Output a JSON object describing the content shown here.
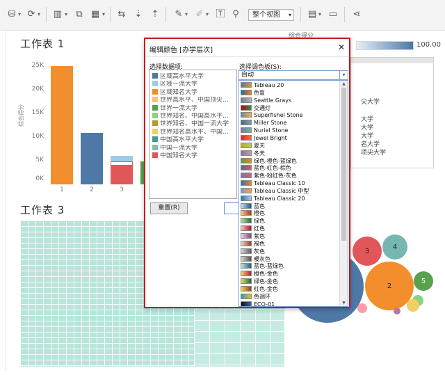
{
  "toolbar": {
    "view_select": "整个视图",
    "icons": [
      "database-icon",
      "refresh-icon",
      "add-chart-icon",
      "duplicate-icon",
      "clear-icon",
      "swap-icon",
      "sort-asc-icon",
      "sort-desc-icon",
      "highlight-icon",
      "pen-icon",
      "label-icon",
      "pin-icon",
      "show-me-icon",
      "presentation-icon",
      "share-icon"
    ]
  },
  "worksheet1": {
    "title": "工作表 1",
    "ylabel": "综合得分",
    "yticks": [
      "25K",
      "20K",
      "15K",
      "10K",
      "5K",
      "0K"
    ],
    "xticks": [
      "1",
      "2",
      "3"
    ]
  },
  "worksheet3": {
    "title": "工作表 3"
  },
  "legend": {
    "title": "综合得分",
    "max_value": "100.00",
    "items": [
      "尖大学",
      "大学",
      "大学",
      "大学",
      "名大学",
      "项尖大学"
    ]
  },
  "bubbles": {
    "labels": [
      "3",
      "4",
      "2",
      "5"
    ]
  },
  "dialog": {
    "title": "编辑颜色 [办学层次]",
    "data_items_label": "选择数据项:",
    "palette_label": "选择调色板(S):",
    "reset_button": "重置(R)",
    "palette_selected": "自动",
    "data_items": [
      {
        "label": "区域高水平大学",
        "color": "#4e79a7"
      },
      {
        "label": "区域一流大学",
        "color": "#a0cbe8"
      },
      {
        "label": "区域知名大学",
        "color": "#f28e2b"
      },
      {
        "label": "世界高水平、中国顶尖...",
        "color": "#ffbe7d"
      },
      {
        "label": "世界一流大学",
        "color": "#59a14f"
      },
      {
        "label": "世界知名、中国高水平...",
        "color": "#8cd17d"
      },
      {
        "label": "世界知名、中国一流大学",
        "color": "#b6992d"
      },
      {
        "label": "世界知名高水平、中国...",
        "color": "#f1ce63"
      },
      {
        "label": "中国高水平大学",
        "color": "#499894"
      },
      {
        "label": "中国一流大学",
        "color": "#86bcb6"
      },
      {
        "label": "中国知名大学",
        "color": "#e15759"
      }
    ],
    "palettes": [
      {
        "name": "Tableau 20",
        "c1": "#4e79a7",
        "c2": "#f28e2b"
      },
      {
        "name": "色盲",
        "c1": "#1170aa",
        "c2": "#fc7d0b"
      },
      {
        "name": "Seattle Grays",
        "c1": "#767f8b",
        "c2": "#b3b7b8"
      },
      {
        "name": "交通灯",
        "c1": "#b10318",
        "c2": "#309143"
      },
      {
        "name": "Superfishel Stone",
        "c1": "#6388b4",
        "c2": "#ffae34"
      },
      {
        "name": "Miller Stone",
        "c1": "#4f6980",
        "c2": "#849db1"
      },
      {
        "name": "Nuriel Stone",
        "c1": "#8175aa",
        "c2": "#6fb899"
      },
      {
        "name": "Jewel Bright",
        "c1": "#eb1e2c",
        "c2": "#fd6f30"
      },
      {
        "name": "夏天",
        "c1": "#bfb202",
        "c2": "#b9ca5d"
      },
      {
        "name": "冬天",
        "c1": "#90728f",
        "c2": "#b9a0b4"
      },
      {
        "name": "绿色-橙色-蓝绿色",
        "c1": "#4e9f50",
        "c2": "#ef8a0c"
      },
      {
        "name": "蓝色-红色-棕色",
        "c1": "#466f9d",
        "c2": "#e3565b"
      },
      {
        "name": "紫色-粉红色-灰色",
        "c1": "#8074a8",
        "c2": "#c46487"
      },
      {
        "name": "Tableau Classic 10",
        "c1": "#1f77b4",
        "c2": "#ff7f0e"
      },
      {
        "name": "Tableau Classic 中型",
        "c1": "#729ece",
        "c2": "#ff9e4a"
      },
      {
        "name": "Tableau Classic 20",
        "c1": "#1f77b4",
        "c2": "#aec7e8"
      },
      {
        "name": "蓝色",
        "c1": "#b9ddf1",
        "c2": "#2a5783"
      },
      {
        "name": "橙色",
        "c1": "#ffc685",
        "c2": "#9e3d22"
      },
      {
        "name": "绿色",
        "c1": "#b3e0a6",
        "c2": "#24693d"
      },
      {
        "name": "红色",
        "c1": "#ffbeb2",
        "c2": "#ae123a"
      },
      {
        "name": "紫色",
        "c1": "#eec9e5",
        "c2": "#7c4d79"
      },
      {
        "name": "褐色",
        "c1": "#eedbbd",
        "c2": "#9f3632"
      },
      {
        "name": "灰色",
        "c1": "#d5d5d5",
        "c2": "#5d5d5d"
      },
      {
        "name": "暖灰色",
        "c1": "#dcd4d0",
        "c2": "#59504e"
      },
      {
        "name": "蓝色-蓝绿色",
        "c1": "#bce4d8",
        "c2": "#2c5985"
      },
      {
        "name": "橙色-金色",
        "c1": "#f4d166",
        "c2": "#b71d3e"
      },
      {
        "name": "绿色-金色",
        "c1": "#f4d166",
        "c2": "#146c36"
      },
      {
        "name": "红色-金色",
        "c1": "#f4d166",
        "c2": "#9e3a26"
      },
      {
        "name": "色调环",
        "c1": "#1ba3c6",
        "c2": "#f8b620"
      },
      {
        "name": "ECO-01",
        "c1": "#111111",
        "c2": "#2f6aa3"
      }
    ]
  },
  "colors": {
    "dialog_border": "#c41c1c",
    "bar_orange": "#f28e2b",
    "bar_blue": "#4e79a7",
    "bar_red": "#e15759",
    "bar_lightblue": "#a0cbe8",
    "treemap": "#b9e4db"
  }
}
